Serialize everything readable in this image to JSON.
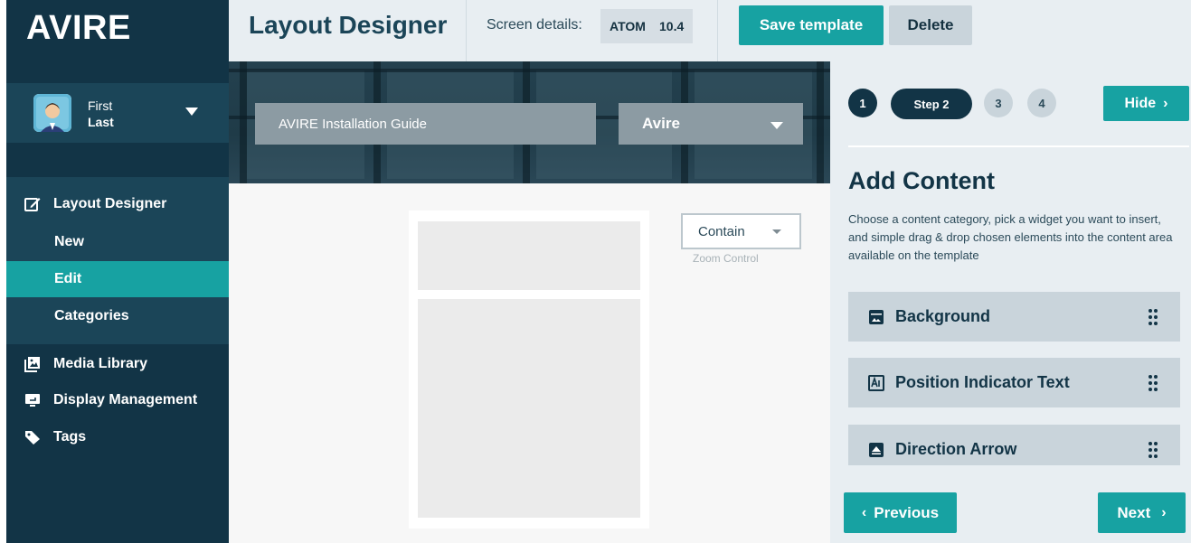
{
  "sidebar": {
    "brand": "AVIRE",
    "user": {
      "first": "First",
      "last": "Last"
    },
    "nav": {
      "layout_designer": "Layout Designer",
      "sub": {
        "new": "New",
        "edit": "Edit",
        "categories": "Categories"
      },
      "media_library": "Media Library",
      "display_management": "Display Management",
      "tags": "Tags"
    }
  },
  "header": {
    "title": "Layout Designer",
    "screen_details_label": "Screen details:",
    "screen_model": "ATOM",
    "screen_size": "10.4",
    "save_label": "Save template",
    "delete_label": "Delete"
  },
  "editor": {
    "document_name": "AVIRE Installation Guide",
    "brand_value": "Avire",
    "zoom_value": "Contain",
    "zoom_label": "Zoom Control"
  },
  "panel": {
    "steps": {
      "one": "1",
      "two": "Step 2",
      "three": "3",
      "four": "4"
    },
    "hide_label": "Hide",
    "title": "Add Content",
    "description": "Choose a content category, pick a widget you want to insert, and simple drag & drop chosen elements into the content area available on the template",
    "widgets": [
      "Background",
      "Position Indicator Text",
      "Direction Arrow"
    ],
    "previous_label": "Previous",
    "next_label": "Next"
  },
  "colors": {
    "navy": "#123446",
    "teal": "#17a2a2",
    "panel": "#e8eef2"
  }
}
